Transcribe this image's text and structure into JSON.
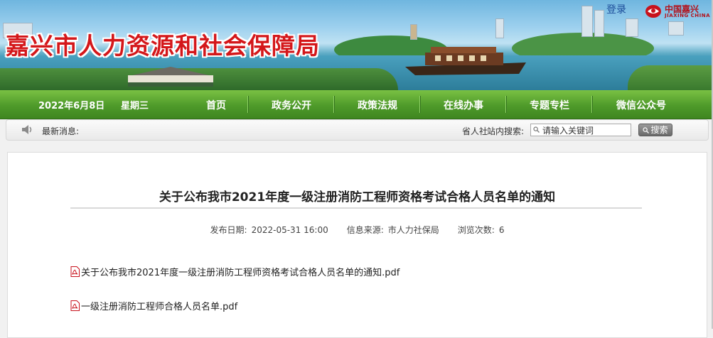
{
  "header": {
    "site_title": "嘉兴市人力资源和社会保障局",
    "login_label": "登录",
    "logo_cn": "中国嘉兴",
    "logo_en": "JIAXING CHINA"
  },
  "nav": {
    "date": "2022年6月8日",
    "weekday": "星期三",
    "items": [
      "首页",
      "政务公开",
      "政策法规",
      "在线办事",
      "专题专栏",
      "微信公众号"
    ]
  },
  "newsbar": {
    "latest_label": "最新消息:",
    "province_label": "省人社",
    "search_label": "站内搜索:",
    "search_placeholder": "请输入关键词",
    "search_button": "搜索"
  },
  "article": {
    "title": "关于公布我市2021年度一级注册消防工程师资格考试合格人员名单的通知",
    "publish_label": "发布日期:",
    "publish_date": "2022-05-31 16:00",
    "source_label": "信息来源:",
    "source": "市人力社保局",
    "views_label": "浏览次数:",
    "views": "6",
    "attachments": [
      "关于公布我市2021年度一级注册消防工程师资格考试合格人员名单的通知.pdf",
      "一级注册消防工程师合格人员名单.pdf"
    ]
  },
  "colors": {
    "title_red": "#d4171a",
    "nav_green": "#4e9a2a",
    "pdf_red": "#c8121c"
  }
}
